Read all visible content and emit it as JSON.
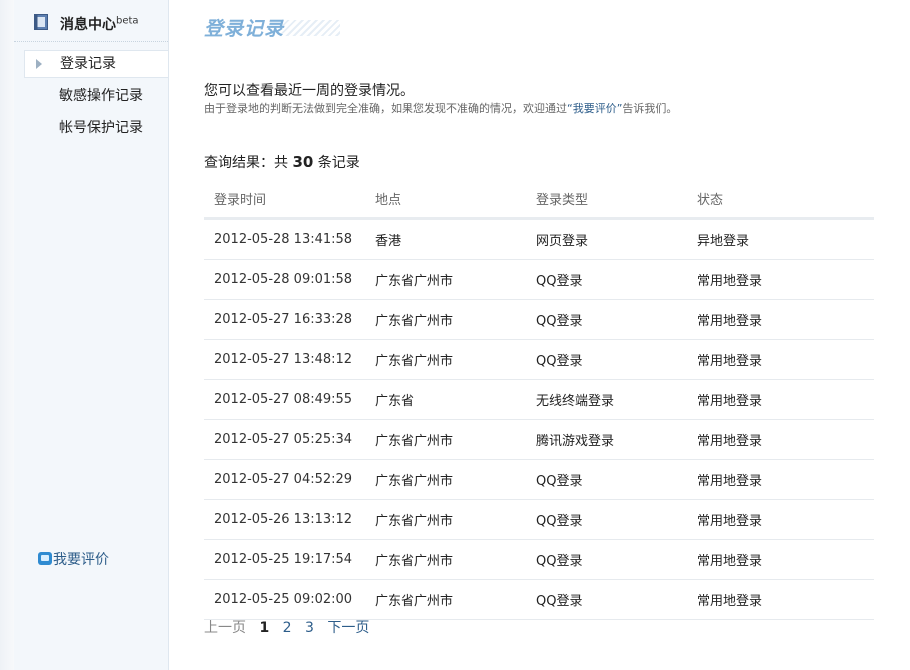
{
  "sidebar": {
    "title": "消息中心",
    "title_sup": "beta",
    "items": [
      {
        "label": "登录记录",
        "active": true
      },
      {
        "label": "敏感操作记录",
        "active": false
      },
      {
        "label": "帐号保护记录",
        "active": false
      }
    ],
    "feedback_label": "我要评价"
  },
  "main": {
    "page_title": "登录记录",
    "intro_line1": "您可以查看最近一周的登录情况。",
    "intro_line2_before": "由于登录地的判断无法做到完全准确，如果您发现不准确的情况，欢迎通过",
    "intro_line2_link": "“我要评价”",
    "intro_line2_after": "告诉我们。",
    "result_prefix": "查询结果：共 ",
    "result_count": "30",
    "result_suffix": " 条记录",
    "columns": [
      "登录时间",
      "地点",
      "登录类型",
      "状态"
    ],
    "rows": [
      {
        "time": "2012-05-28 13:41:58",
        "place": "香港",
        "type": "网页登录",
        "status": "异地登录"
      },
      {
        "time": "2012-05-28 09:01:58",
        "place": "广东省广州市",
        "type": "QQ登录",
        "status": "常用地登录"
      },
      {
        "time": "2012-05-27 16:33:28",
        "place": "广东省广州市",
        "type": "QQ登录",
        "status": "常用地登录"
      },
      {
        "time": "2012-05-27 13:48:12",
        "place": "广东省广州市",
        "type": "QQ登录",
        "status": "常用地登录"
      },
      {
        "time": "2012-05-27 08:49:55",
        "place": "广东省",
        "type": "无线终端登录",
        "status": "常用地登录"
      },
      {
        "time": "2012-05-27 05:25:34",
        "place": "广东省广州市",
        "type": "腾讯游戏登录",
        "status": "常用地登录"
      },
      {
        "time": "2012-05-27 04:52:29",
        "place": "广东省广州市",
        "type": "QQ登录",
        "status": "常用地登录"
      },
      {
        "time": "2012-05-26 13:13:12",
        "place": "广东省广州市",
        "type": "QQ登录",
        "status": "常用地登录"
      },
      {
        "time": "2012-05-25 19:17:54",
        "place": "广东省广州市",
        "type": "QQ登录",
        "status": "常用地登录"
      },
      {
        "time": "2012-05-25 09:02:00",
        "place": "广东省广州市",
        "type": "QQ登录",
        "status": "常用地登录"
      }
    ],
    "pager": {
      "prev": "上一页",
      "pages": [
        "1",
        "2",
        "3"
      ],
      "current": "1",
      "next": "下一页"
    }
  },
  "colors": {
    "title_accent": "#7fb0d9",
    "link": "#2d5d8a",
    "sidebar_bg": "#f3f7fb"
  }
}
